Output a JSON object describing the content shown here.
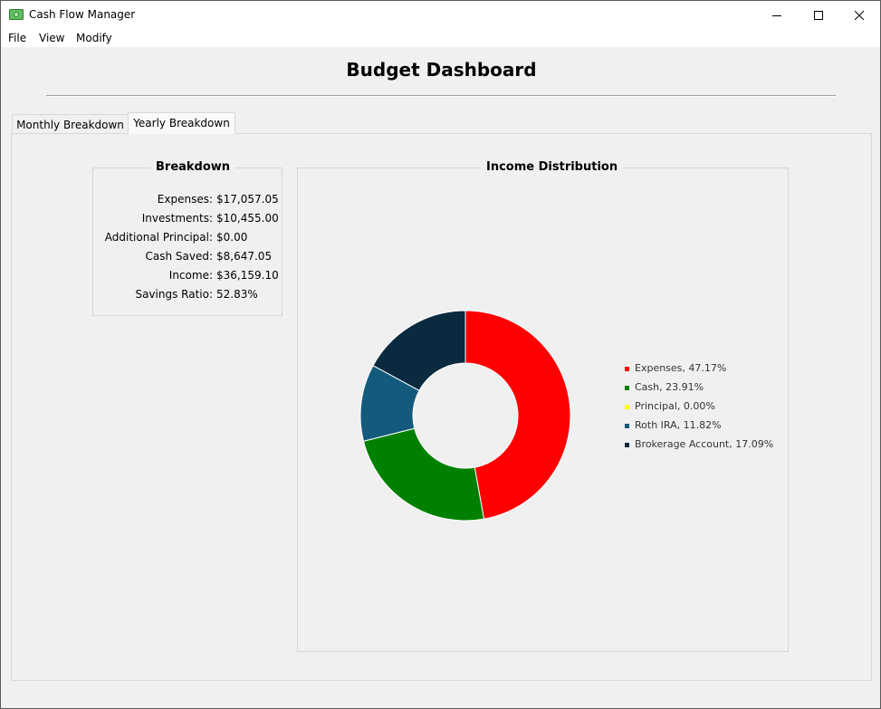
{
  "window": {
    "title": "Cash Flow Manager"
  },
  "menu": {
    "file": "File",
    "view": "View",
    "modify": "Modify"
  },
  "dashboard": {
    "title": "Budget Dashboard"
  },
  "tabs": [
    {
      "label": "Monthly Breakdown",
      "selected": false
    },
    {
      "label": "Yearly Breakdown",
      "selected": true
    }
  ],
  "breakdown": {
    "title": "Breakdown",
    "rows": [
      {
        "label": "Expenses:",
        "value": "$17,057.05"
      },
      {
        "label": "Investments:",
        "value": "$10,455.00"
      },
      {
        "label": "Additional Principal:",
        "value": "$0.00"
      },
      {
        "label": "Cash Saved:",
        "value": "$8,647.05"
      },
      {
        "label": "Income:",
        "value": "$36,159.10"
      },
      {
        "label": "Savings Ratio:",
        "value": "52.83%"
      }
    ]
  },
  "income_distribution": {
    "title": "Income Distribution",
    "legend": [
      "Expenses, 47.17%",
      "Cash, 23.91%",
      "Principal, 0.00%",
      "Roth IRA, 11.82%",
      "Brokerage Account, 17.09%"
    ]
  },
  "chart_data": {
    "type": "pie",
    "title": "Income Distribution",
    "categories": [
      "Expenses",
      "Cash",
      "Principal",
      "Roth IRA",
      "Brokerage Account"
    ],
    "values": [
      47.17,
      23.91,
      0.0,
      11.82,
      17.09
    ],
    "colors": [
      "#ff0000",
      "#008000",
      "#ffff00",
      "#135a7c",
      "#0a2a40"
    ],
    "donut": true,
    "legend_position": "right"
  }
}
